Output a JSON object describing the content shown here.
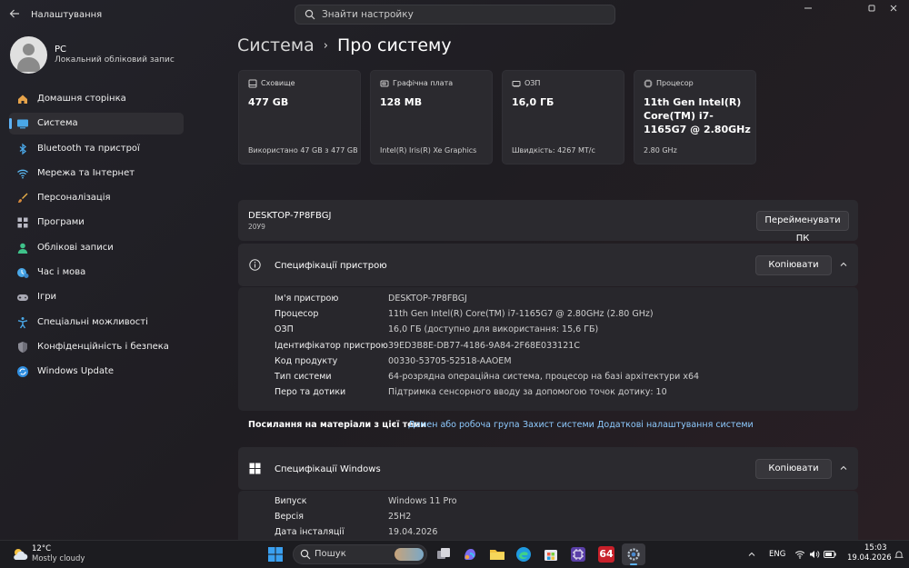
{
  "window": {
    "app_title": "Налаштування",
    "search_placeholder": "Знайти настройку"
  },
  "profile": {
    "name": "PC",
    "account_type": "Локальний обліковий запис"
  },
  "sidebar": {
    "items": [
      {
        "label": "Домашня сторінка",
        "icon": "home-icon"
      },
      {
        "label": "Система",
        "icon": "system-icon",
        "active": true
      },
      {
        "label": "Bluetooth та пристрої",
        "icon": "bluetooth-icon"
      },
      {
        "label": "Мережа та Інтернет",
        "icon": "wifi-icon"
      },
      {
        "label": "Персоналізація",
        "icon": "brush-icon"
      },
      {
        "label": "Програми",
        "icon": "apps-icon"
      },
      {
        "label": "Облікові записи",
        "icon": "accounts-icon"
      },
      {
        "label": "Час і мова",
        "icon": "time-language-icon"
      },
      {
        "label": "Ігри",
        "icon": "gamepad-icon"
      },
      {
        "label": "Спеціальні можливості",
        "icon": "accessibility-icon"
      },
      {
        "label": "Конфіденційність і безпека",
        "icon": "shield-icon"
      },
      {
        "label": "Windows Update",
        "icon": "update-icon"
      }
    ]
  },
  "breadcrumb": {
    "parent": "Система",
    "separator": "›",
    "current": "Про систему"
  },
  "cards": [
    {
      "title": "Сховище",
      "value": "477 GB",
      "sub": "Використано 47 GB з 477 GB",
      "icon": "storage-icon"
    },
    {
      "title": "Графічна плата",
      "value": "128 MB",
      "sub": "Intel(R) Iris(R) Xe Graphics",
      "icon": "gpu-icon"
    },
    {
      "title": "ОЗП",
      "value": "16,0 ГБ",
      "sub": "Швидкість: 4267 MT/c",
      "icon": "ram-icon"
    },
    {
      "title": "Процесор",
      "value": "11th Gen Intel(R) Core(TM) i7-1165G7 @ 2.80GHz",
      "sub": "2.80 GHz",
      "icon": "cpu-icon"
    }
  ],
  "device": {
    "name": "DESKTOP-7P8FBGJ",
    "model": "20У9",
    "rename_button": "Перейменувати ПК"
  },
  "device_specs": {
    "title": "Специфікації пристрою",
    "copy_button": "Копіювати",
    "rows": [
      {
        "key": "Ім'я пристрою",
        "value": "DESKTOP-7P8FBGJ"
      },
      {
        "key": "Процесор",
        "value": "11th Gen Intel(R) Core(TM) i7-1165G7 @ 2.80GHz (2.80 GHz)"
      },
      {
        "key": "ОЗП",
        "value": "16,0 ГБ (доступно для використання: 15,6 ГБ)"
      },
      {
        "key": "Ідентифікатор пристрою",
        "value": "39ED3B8E-DB77-4186-9A84-2F68E033121C"
      },
      {
        "key": "Код продукту",
        "value": "00330-53705-52518-AAOEM"
      },
      {
        "key": "Тип системи",
        "value": "64-розрядна операційна система, процесор на базі архітектури x64"
      },
      {
        "key": "Перо та дотики",
        "value": "Підтримка сенсорного вводу за допомогою точок дотику: 10"
      }
    ]
  },
  "related_links": {
    "title": "Посилання на матеріали з цієї теми",
    "links": [
      "Домен або робоча група",
      "Захист системи",
      "Додаткові налаштування системи"
    ]
  },
  "windows_specs": {
    "title": "Специфікації Windows",
    "copy_button": "Копіювати",
    "rows": [
      {
        "key": "Випуск",
        "value": "Windows 11 Pro"
      },
      {
        "key": "Версія",
        "value": "25H2"
      },
      {
        "key": "Дата інсталяції",
        "value": "19.04.2026"
      }
    ]
  },
  "taskbar": {
    "weather_temp": "12°C",
    "weather_desc": "Mostly cloudy",
    "search_placeholder": "Пошук",
    "language": "ENG",
    "time": "15:03",
    "date": "19.04.2026",
    "badge": "64"
  },
  "colors": {
    "accent": "#5fb3f5",
    "link": "#8ecbff",
    "panel": "#2b2a2f"
  }
}
